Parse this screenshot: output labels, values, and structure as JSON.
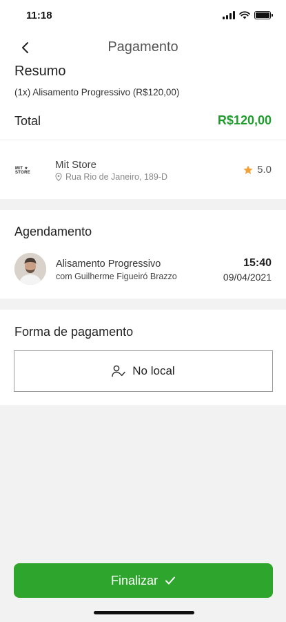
{
  "status_bar": {
    "time": "11:18"
  },
  "header": {
    "title": "Pagamento"
  },
  "summary": {
    "title": "Resumo",
    "item": "(1x) Alisamento Progressivo (R$120,00)",
    "total_label": "Total",
    "total_value": "R$120,00"
  },
  "store": {
    "logo_text": "MIT ★ STORE",
    "name": "Mit Store",
    "address": "Rua Rio de Janeiro, 189-D",
    "rating": "5.0"
  },
  "schedule": {
    "title": "Agendamento",
    "service": "Alisamento Progressivo",
    "professional": "com Guilherme Figueiró Brazzo",
    "time": "15:40",
    "date": "09/04/2021"
  },
  "payment": {
    "title": "Forma de pagamento",
    "option_label": "No local"
  },
  "actions": {
    "finish_label": "Finalizar"
  },
  "colors": {
    "accent_green": "#2ea52c",
    "total_green": "#1f9d2c",
    "star": "#f0a33a"
  },
  "icons": [
    "back-arrow-icon",
    "location-pin-icon",
    "star-icon",
    "user-check-icon",
    "check-icon"
  ]
}
